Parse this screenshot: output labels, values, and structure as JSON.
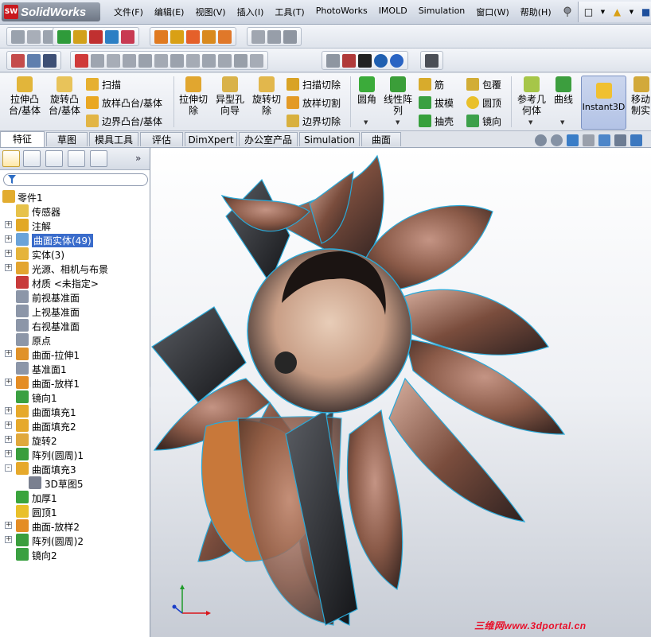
{
  "app": {
    "name": "SolidWorks",
    "logo_badge": "SW"
  },
  "menus": [
    "文件(F)",
    "编辑(E)",
    "视图(V)",
    "插入(I)",
    "工具(T)",
    "PhotoWorks",
    "IMOLD",
    "Simulation",
    "窗口(W)",
    "帮助(H)"
  ],
  "ribbon": {
    "extrude_boss": "拉伸凸\n台/基体",
    "revolve_boss": "旋转凸\n台/基体",
    "sweep": "扫描",
    "loft_boss": "放样凸台/基体",
    "boundary_boss": "边界凸台/基体",
    "extrude_cut": "拉伸切\n除",
    "hole_wizard": "异型孔\n向导",
    "revolve_cut": "旋转切\n除",
    "swept_cut": "扫描切除",
    "lofted_cut": "放样切割",
    "boundary_cut": "边界切除",
    "fillet": "圆角",
    "linear_pattern": "线性阵\n列",
    "rib": "筋",
    "draft": "拔模",
    "shell": "抽壳",
    "wrap": "包覆",
    "dome": "圆顶",
    "mirror": "镜向",
    "ref_geometry": "参考几\n何体",
    "curves": "曲线",
    "instant3d": "Instant3D",
    "move_copy": "移动\n制实"
  },
  "tabs": [
    "特征",
    "草图",
    "模具工具",
    "评估",
    "DimXpert",
    "办公室产品",
    "Simulation",
    "曲面"
  ],
  "active_tab": "特征",
  "tree": [
    {
      "label": "零件1",
      "icon": "part-icon",
      "level": 0,
      "expander": ""
    },
    {
      "label": "传感器",
      "icon": "sensor-icon",
      "level": 1,
      "expander": ""
    },
    {
      "label": "注解",
      "icon": "annotation-icon",
      "level": 1,
      "expander": "+"
    },
    {
      "label": "曲面实体(49)",
      "icon": "surface-bodies-icon",
      "level": 1,
      "expander": "+",
      "selected": true
    },
    {
      "label": "实体(3)",
      "icon": "solid-bodies-icon",
      "level": 1,
      "expander": "+"
    },
    {
      "label": "光源、相机与布景",
      "icon": "lights-icon",
      "level": 1,
      "expander": "+"
    },
    {
      "label": "材质 <未指定>",
      "icon": "material-icon",
      "level": 1,
      "expander": ""
    },
    {
      "label": "前视基准面",
      "icon": "plane-icon",
      "level": 1,
      "expander": ""
    },
    {
      "label": "上视基准面",
      "icon": "plane-icon",
      "level": 1,
      "expander": ""
    },
    {
      "label": "右视基准面",
      "icon": "plane-icon",
      "level": 1,
      "expander": ""
    },
    {
      "label": "原点",
      "icon": "origin-icon",
      "level": 1,
      "expander": ""
    },
    {
      "label": "曲面-拉伸1",
      "icon": "surface-extrude-icon",
      "level": 1,
      "expander": "+"
    },
    {
      "label": "基准面1",
      "icon": "plane-icon",
      "level": 1,
      "expander": ""
    },
    {
      "label": "曲面-放样1",
      "icon": "surface-loft-icon",
      "level": 1,
      "expander": "+"
    },
    {
      "label": "镜向1",
      "icon": "mirror-icon",
      "level": 1,
      "expander": ""
    },
    {
      "label": "曲面填充1",
      "icon": "fill-surface-icon",
      "level": 1,
      "expander": "+"
    },
    {
      "label": "曲面填充2",
      "icon": "fill-surface-icon",
      "level": 1,
      "expander": "+"
    },
    {
      "label": "旋转2",
      "icon": "revolve-icon",
      "level": 1,
      "expander": "+"
    },
    {
      "label": "阵列(圆周)1",
      "icon": "circular-pattern-icon",
      "level": 1,
      "expander": "+"
    },
    {
      "label": "曲面填充3",
      "icon": "fill-surface-icon",
      "level": 1,
      "expander": "-"
    },
    {
      "label": "3D草图5",
      "icon": "sketch3d-icon",
      "level": 2,
      "expander": ""
    },
    {
      "label": "加厚1",
      "icon": "thicken-icon",
      "level": 1,
      "expander": ""
    },
    {
      "label": "圆顶1",
      "icon": "dome-icon",
      "level": 1,
      "expander": ""
    },
    {
      "label": "曲面-放样2",
      "icon": "surface-loft-icon",
      "level": 1,
      "expander": "+"
    },
    {
      "label": "阵列(圆周)2",
      "icon": "circular-pattern-icon",
      "level": 1,
      "expander": "+"
    },
    {
      "label": "镜向2",
      "icon": "mirror-icon",
      "level": 1,
      "expander": ""
    }
  ],
  "watermark": "三维网www.3dportal.cn",
  "colors": {
    "menubar": "#d6dce6",
    "selection": "#3a6ccb",
    "model_edge": "#2aa9d8",
    "model_copper": "#8a5a48",
    "watermark": "#e8102a"
  }
}
